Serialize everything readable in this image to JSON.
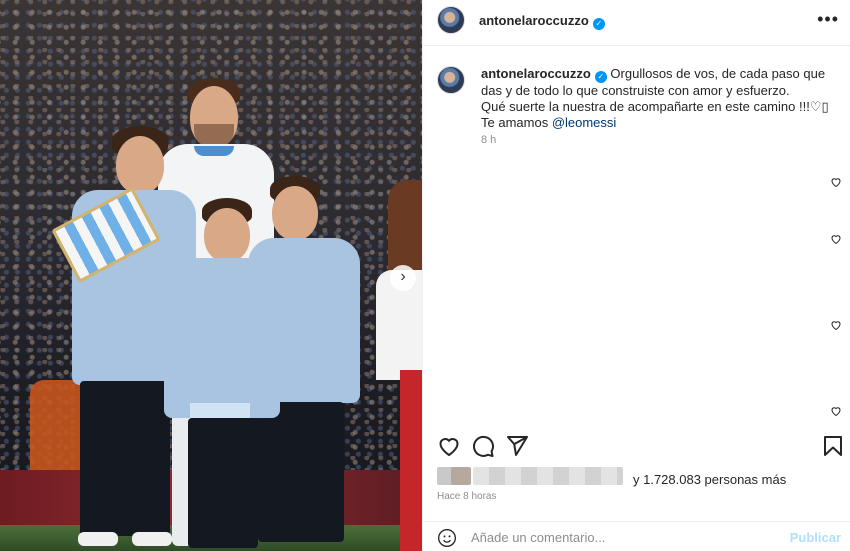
{
  "post": {
    "username": "antonelaroccuzzo",
    "verified_mark": "✓",
    "more_label": "•••",
    "caption": {
      "username": "antonelaroccuzzo",
      "line1": "Orgullosos de vos, de cada paso que das y de todo lo que construiste con amor y esfuerzo.",
      "line2": "Qué suerte la nuestra de acompañarte en este camino !!!♡▯",
      "line3_prefix": "Te amamos ",
      "mention": "@leomessi",
      "age": "8 h"
    },
    "likes_text": "y 1.728.083 personas más",
    "timestamp": "Hace 8 horas",
    "comment_placeholder": "Añade un comentario...",
    "publish_label": "Publicar",
    "carousel_next": "›"
  },
  "icons": [
    "verified-icon",
    "more-icon",
    "heart-icon",
    "comment-icon",
    "share-icon",
    "bookmark-icon",
    "emoji-icon",
    "chevron-right-icon"
  ],
  "colors": {
    "link": "#00376b",
    "verified": "#0095f6",
    "muted": "#8e8e8e",
    "publish_disabled": "#b2dffc"
  }
}
